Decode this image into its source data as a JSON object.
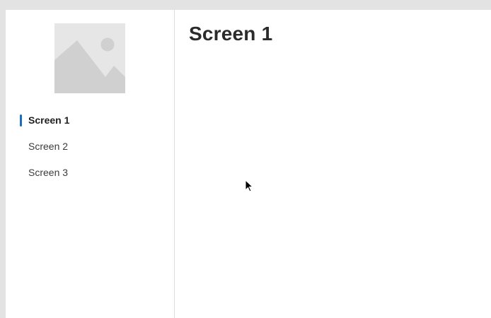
{
  "sidebar": {
    "logo_icon": "image-placeholder-icon",
    "items": [
      {
        "label": "Screen 1",
        "active": true
      },
      {
        "label": "Screen 2",
        "active": false
      },
      {
        "label": "Screen 3",
        "active": false
      }
    ]
  },
  "main": {
    "title": "Screen 1"
  },
  "colors": {
    "accent": "#1a6dbf",
    "placeholder_bg": "#e6e6e6",
    "placeholder_fg": "#cfcfcf"
  }
}
